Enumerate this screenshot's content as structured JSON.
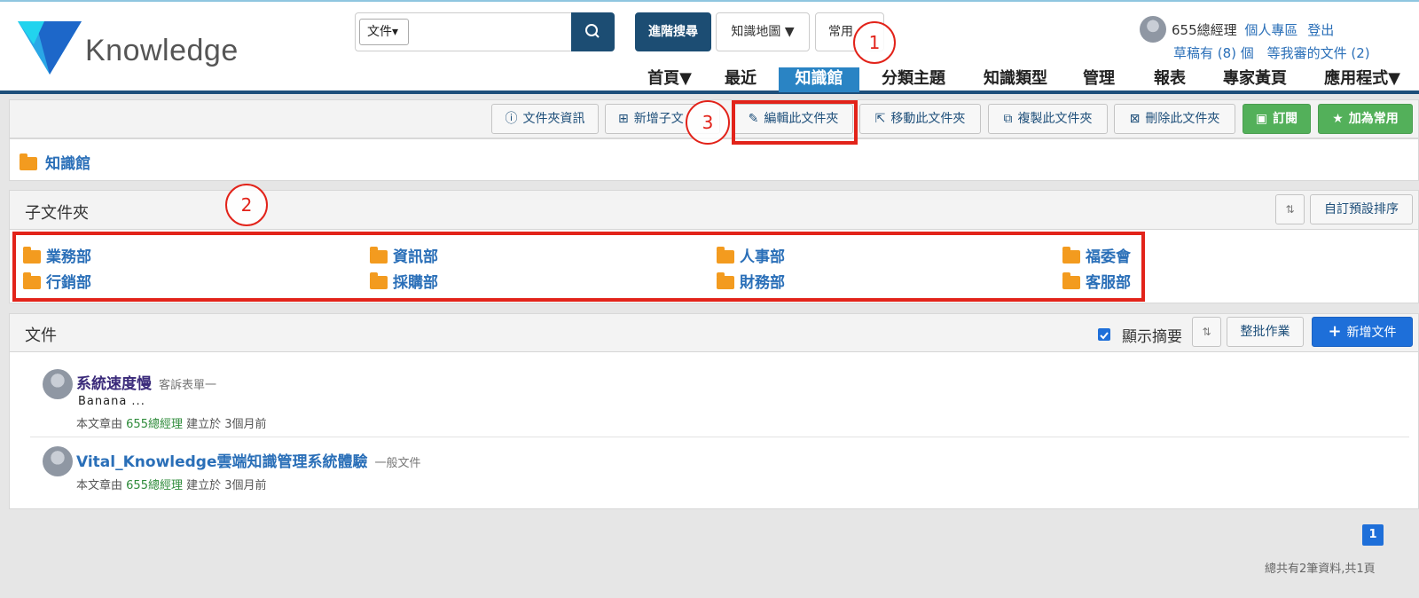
{
  "logo": {
    "text": "Knowledge"
  },
  "search": {
    "scope": "文件▾",
    "placeholder": ""
  },
  "header_buttons": {
    "advanced": "進階搜尋",
    "map": "知識地圖 ▼",
    "common": "常用"
  },
  "user": {
    "name": "655總經理",
    "personal": "個人專區",
    "logout": "登出",
    "drafts": "草稿有 (8) 個",
    "review": "等我審的文件 (2)"
  },
  "nav": [
    "首頁▼",
    "最近",
    "知識館",
    "分類主題",
    "知識類型",
    "管理",
    "報表",
    "專家黃頁",
    "應用程式▼"
  ],
  "toolbar": {
    "folder_info": "文件夾資訊",
    "new_sub": "新增子文",
    "edit": "編輯此文件夾",
    "move": "移動此文件夾",
    "copy": "複製此文件夾",
    "delete": "刪除此文件夾",
    "subscribe": "訂閱",
    "add_common": "加為常用"
  },
  "breadcrumb": "知識館",
  "subfolders": {
    "title": "子文件夾",
    "custom_sort": "自訂預設排序",
    "items": [
      "業務部",
      "資訊部",
      "人事部",
      "福委會",
      "行銷部",
      "採購部",
      "財務部",
      "客服部"
    ]
  },
  "documents": {
    "title": "文件",
    "show_summary": "顯示摘要",
    "batch": "整批作業",
    "new_doc": "新增文件",
    "items": [
      {
        "title": "系統速度慢",
        "type": "客訴表單一",
        "summary": "Banana ...",
        "meta_prefix": "本文章由",
        "author": "655總經理",
        "meta_suffix": "建立於 3個月前"
      },
      {
        "title": "Vital_Knowledge雲端知識管理系統體驗",
        "type": "一般文件",
        "summary": "",
        "meta_prefix": "本文章由",
        "author": "655總經理",
        "meta_suffix": "建立於 3個月前"
      }
    ]
  },
  "pagination": {
    "current": "1",
    "summary": "總共有2筆資料,共1頁"
  },
  "annotations": {
    "a1": "1",
    "a2": "2",
    "a3": "3"
  },
  "colors": {
    "accent": "#2a84c4",
    "brand": "#1c4d73",
    "annotation": "#e2231a",
    "folder": "#f39b1f",
    "green": "#53b05a"
  }
}
